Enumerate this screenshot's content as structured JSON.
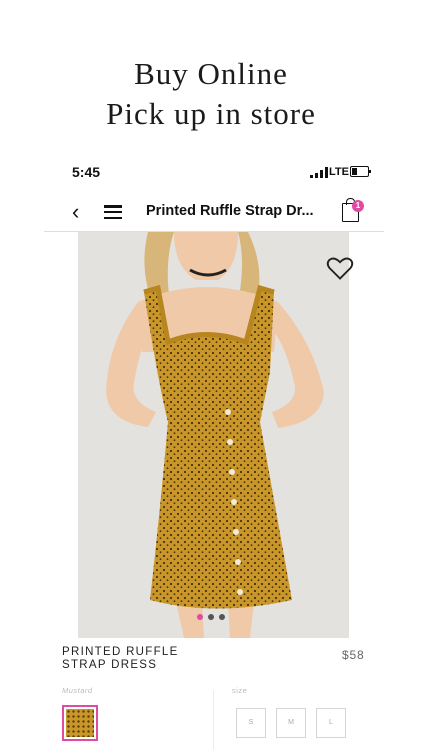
{
  "promo": {
    "line1": "Buy Online",
    "line2": "Pick up in store"
  },
  "status_bar": {
    "time": "5:45",
    "network": "LTE"
  },
  "nav": {
    "title": "Printed Ruffle Strap Dr...",
    "cart_count": "1"
  },
  "product": {
    "name_line1": "PRINTED RUFFLE",
    "name_line2": "STRAP DRESS",
    "price": "$58",
    "color_label": "Mustard",
    "size_label": "size",
    "sizes": [
      "S",
      "M",
      "L"
    ],
    "image_count": 3,
    "current_image": 1
  },
  "colors": {
    "accent": "#e04aa0",
    "dress": "#c9962a"
  }
}
